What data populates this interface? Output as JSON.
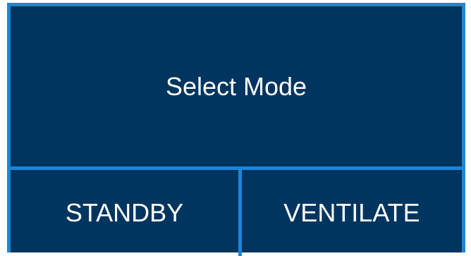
{
  "mode_panel": {
    "title": "Select Mode",
    "buttons": [
      {
        "label": "STANDBY"
      },
      {
        "label": "VENTILATE"
      }
    ]
  },
  "colors": {
    "panel_background": "#00355f",
    "border": "#1a87d8",
    "text": "#ffffff"
  }
}
